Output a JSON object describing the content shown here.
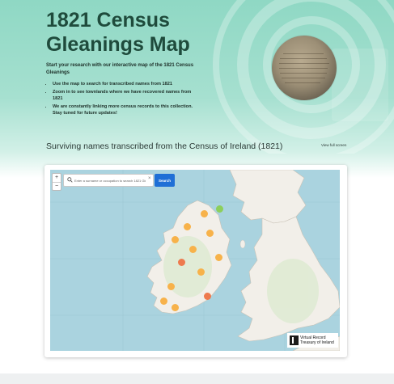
{
  "page": {
    "title": "1821 Census Gleanings Map",
    "intro": "Start your research with our interactive map of the 1821 Census Gleanings",
    "bullets": [
      "Use the map to search for transcribed names from 1821",
      "Zoom in to see townlands where we have recovered names from 1821",
      "We are constantly linking more census records to this collection. Stay tuned for future updates!"
    ],
    "section_title": "Surviving names transcribed from the Census of Ireland (1821)",
    "fullscreen_link": "View full screen"
  },
  "map": {
    "zoom_in": "+",
    "zoom_out": "−",
    "search_placeholder": "Enter a surname or occupation to search 1821 Glea",
    "clear_label": "×",
    "search_button": "Search",
    "attribution_line1": "Virtual Record",
    "attribution_line2": "Treasury of Ireland",
    "icons": [
      "search-icon",
      "clear-icon"
    ]
  },
  "colors": {
    "hero": "#a6e0d0",
    "title": "#1f4b3c",
    "accent": "#1f6fd6",
    "water": "#aad3df",
    "land": "#f2efe9",
    "cluster_orange": "#f7b24a",
    "cluster_red": "#ee7a4e",
    "cluster_green": "#8ccf5b"
  }
}
